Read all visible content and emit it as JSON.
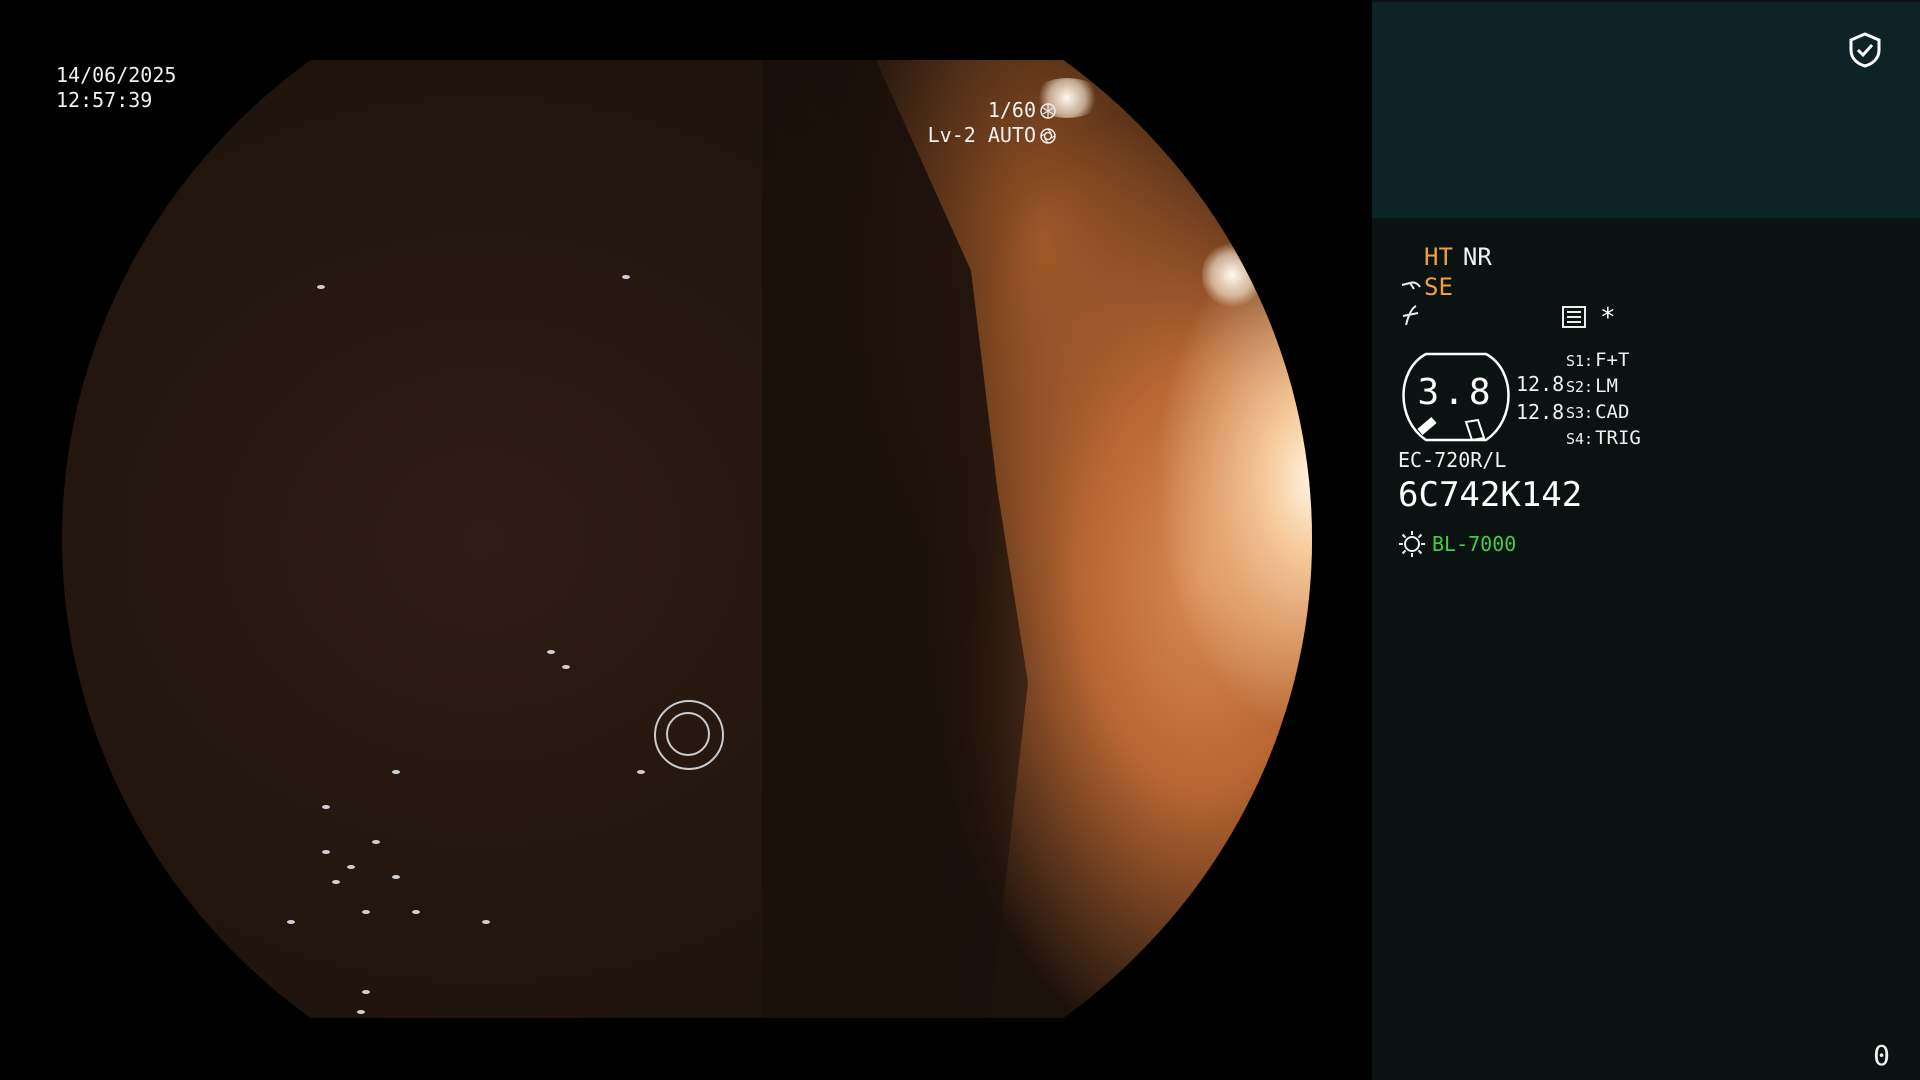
{
  "overlay": {
    "date": "14/06/2025",
    "time": "12:57:39",
    "shutter": "1/60",
    "iris_mode": "Lv-2 AUTO"
  },
  "panel": {
    "ht": "HT",
    "nr": "NR",
    "se": "SE",
    "zoom_value": "3.8",
    "num_top": "12.8",
    "num_bottom": "12.8",
    "settings": [
      {
        "key": "S1:",
        "value": "F+T"
      },
      {
        "key": "S2:",
        "value": "LM"
      },
      {
        "key": "S3:",
        "value": "CAD"
      },
      {
        "key": "S4:",
        "value": "TRIG"
      }
    ],
    "asterisk": "*",
    "scope_model": "EC-720R/L",
    "scope_serial": "6C742K142",
    "light_source": "BL-7000",
    "counter": "0"
  },
  "colors": {
    "panel_bg": "#0a1212",
    "panel_top_bg": "#0d2426",
    "accent_orange": "#f0a03a",
    "accent_green": "#44cc44"
  },
  "icons": [
    "shutter-icon",
    "iris-icon",
    "shield-check-icon",
    "scope-tip-icon",
    "f-mode-icon",
    "list-icon",
    "sun-icon"
  ]
}
